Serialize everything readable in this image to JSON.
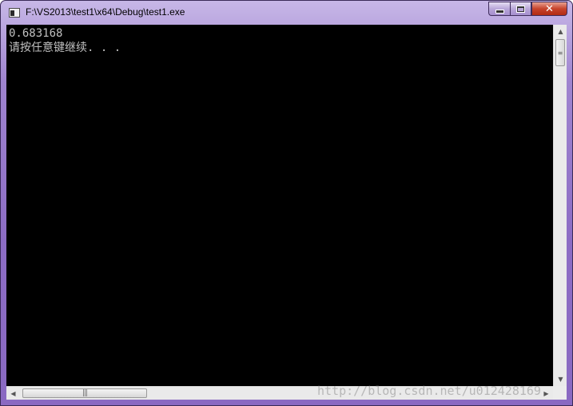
{
  "window": {
    "title": "F:\\VS2013\\test1\\x64\\Debug\\test1.exe",
    "icon": "console-app-icon",
    "controls": {
      "minimize_icon": "minimize-icon",
      "maximize_icon": "maximize-icon",
      "close_glyph": "✕"
    }
  },
  "console": {
    "lines": [
      "0.683168",
      "请按任意键继续. . ."
    ],
    "background": "#000000",
    "text_color": "#c0c0c0"
  },
  "scrollbars": {
    "vertical": {
      "up_arrow": "▲",
      "down_arrow": "▼",
      "grip": "≡"
    },
    "horizontal": {
      "left_arrow": "◀",
      "right_arrow": "▶",
      "grip": "|||"
    }
  },
  "watermark": "http://blog.csdn.net/u012428169",
  "colors": {
    "title_bar": "#9f84cf",
    "close_button": "#c7432c"
  }
}
